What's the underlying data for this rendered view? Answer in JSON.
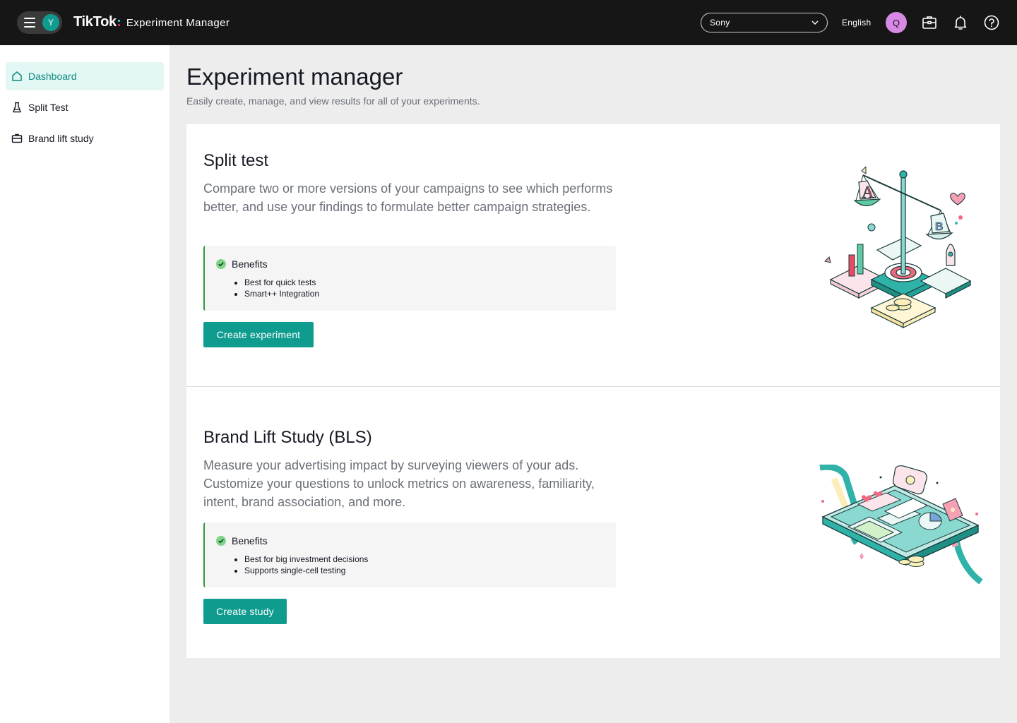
{
  "topbar": {
    "user_initial": "Y",
    "brand_logo": "TikTok",
    "product_name": "Experiment Manager",
    "advertiser": "Sony",
    "language": "English",
    "account_initial": "Q",
    "icons": [
      "menu-icon",
      "chevron-down-icon",
      "toolbox-icon",
      "bell-icon",
      "help-icon"
    ]
  },
  "sidebar": {
    "items": [
      {
        "label": "Dashboard",
        "icon": "home-icon",
        "active": true
      },
      {
        "label": "Split Test",
        "icon": "flask-icon",
        "active": false
      },
      {
        "label": "Brand lift study",
        "icon": "briefcase-icon",
        "active": false
      }
    ]
  },
  "page": {
    "title": "Experiment manager",
    "subtitle": "Easily create, manage, and view results for all of your experiments."
  },
  "cards": [
    {
      "title": "Split test",
      "description": "Compare two or more versions of your campaigns to see which performs better, and use your findings to formulate better campaign strategies.",
      "benefits_title": "Benefits",
      "benefits": [
        "Best for quick tests",
        "Smart++ Integration"
      ],
      "button": "Create experiment"
    },
    {
      "title": "Brand Lift Study (BLS)",
      "description": "Measure your advertising impact by surveying viewers of your ads. Customize your questions to unlock metrics on awareness, familiarity, intent, brand association, and more.",
      "benefits_title": "Benefits",
      "benefits": [
        "Best for big investment decisions",
        "Supports single-cell testing"
      ],
      "button": "Create study"
    }
  ],
  "colors": {
    "topbar": "#161616",
    "accent": "#0f9c8f",
    "active_nav_bg": "#e3f7f5",
    "benefit_border": "#2f9a3f",
    "avatar": "#d68ae4"
  }
}
